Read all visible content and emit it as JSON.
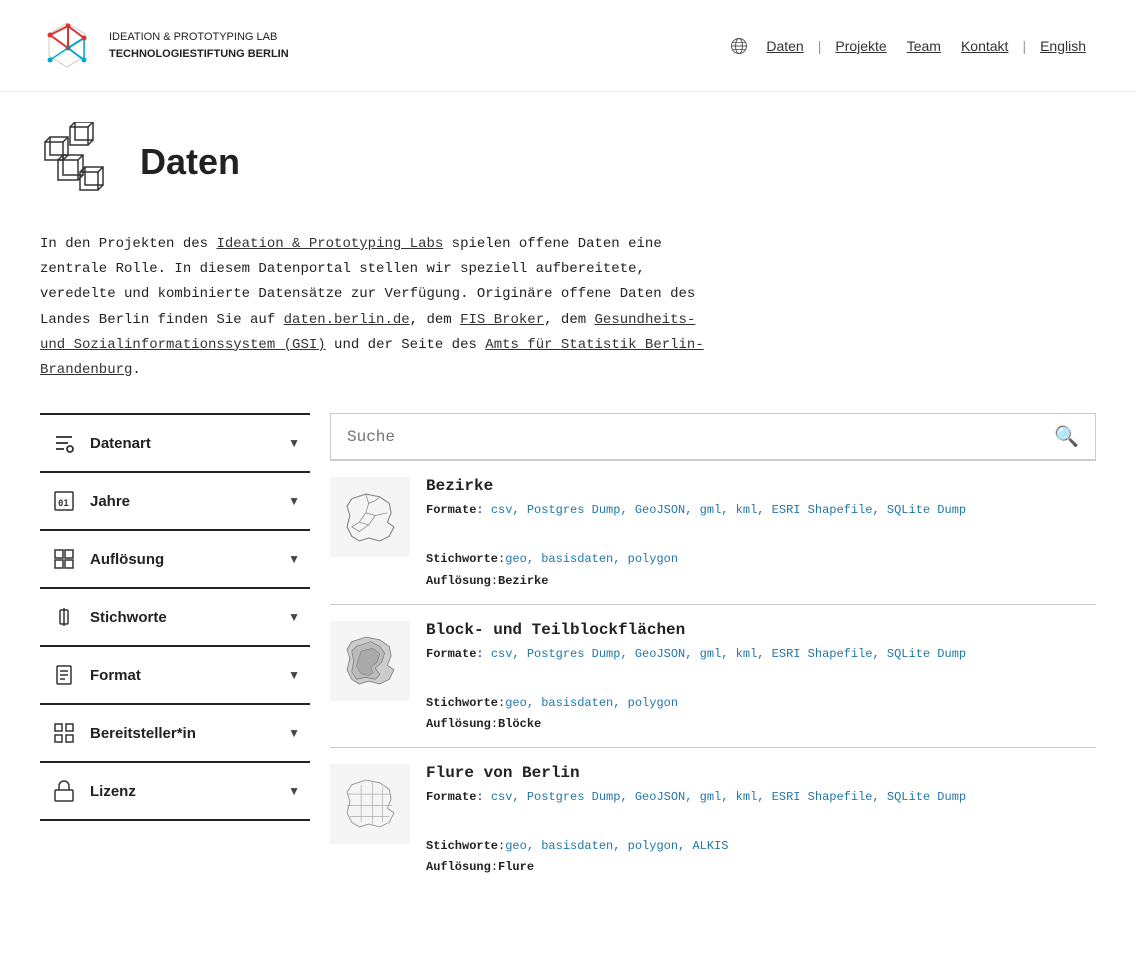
{
  "header": {
    "logo_line1": "IDEATION & PROTOTYPING LAB",
    "logo_line2": "TECHNOLOGIESTIFTUNG BERLIN",
    "nav_items": [
      {
        "label": "Daten",
        "active": true
      },
      {
        "label": "Projekte"
      },
      {
        "label": "Team"
      },
      {
        "label": "Kontakt"
      }
    ],
    "lang": "English"
  },
  "hero": {
    "title": "Daten"
  },
  "intro": {
    "text_before_link1": "In den Projekten des ",
    "link1": "Ideation & Prototyping Labs",
    "text_after_link1": " spielen offene Daten eine zentrale Rolle. In diesem Datenportal stellen wir speziell aufbereitete, veredelte und kombinierte Datensätze zur Verfügung. Originäre offene Daten des Landes Berlin finden Sie auf ",
    "link2": "daten.berlin.de",
    "text2": ", dem ",
    "link3": "FIS Broker",
    "text3": ", dem ",
    "link4": "Gesundheits- und Sozialinformationssystem (GSI)",
    "text4": " und der Seite des ",
    "link5": "Amts für Statistik Berlin-Brandenburg",
    "text5": "."
  },
  "sidebar": {
    "items": [
      {
        "id": "datenart",
        "label": "Datenart"
      },
      {
        "id": "jahre",
        "label": "Jahre"
      },
      {
        "id": "aufloesung",
        "label": "Auflösung"
      },
      {
        "id": "stichworte",
        "label": "Stichworte"
      },
      {
        "id": "format",
        "label": "Format"
      },
      {
        "id": "bereitsteller",
        "label": "Bereitsteller*in"
      },
      {
        "id": "lizenz",
        "label": "Lizenz"
      }
    ]
  },
  "search": {
    "placeholder": "Suche"
  },
  "results": [
    {
      "id": "bezirke",
      "title": "Bezirke",
      "formate": "csv, Postgres Dump, GeoJSON, gml, kml, ESRI Shapefile, SQLite Dump",
      "stichworte": "geo, basisdaten, polygon",
      "aufloesung": "Bezirke"
    },
    {
      "id": "block-teilblock",
      "title": "Block- und Teilblockflächen",
      "formate": "csv, Postgres Dump, GeoJSON, gml, kml, ESRI Shapefile, SQLite Dump",
      "stichworte": "geo, basisdaten, polygon",
      "aufloesung": "Blöcke"
    },
    {
      "id": "flure",
      "title": "Flure von Berlin",
      "formate": "csv, Postgres Dump, GeoJSON, gml, kml, ESRI Shapefile, SQLite Dump",
      "stichworte": "geo, basisdaten, polygon, ALKIS",
      "aufloesung": "Flure"
    }
  ],
  "labels": {
    "formate": "Formate",
    "stichworte": "Stichworte",
    "aufloesung": "Auflösung"
  }
}
